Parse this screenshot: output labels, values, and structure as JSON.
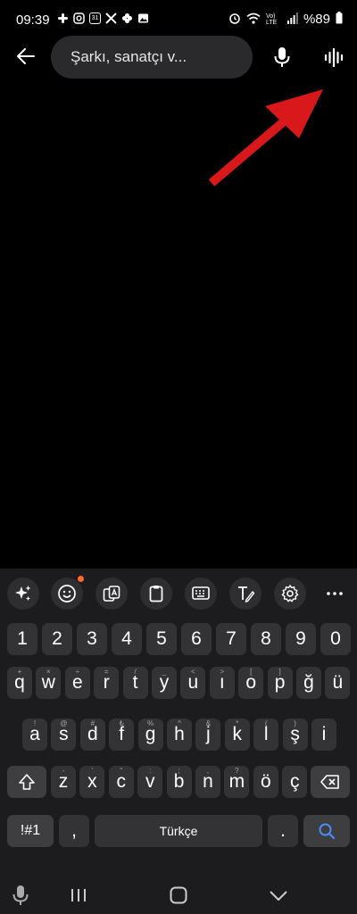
{
  "status_bar": {
    "time": "09:39",
    "notification_icons": [
      "slack-icon",
      "instagram-icon",
      "calendar-31-icon",
      "x-icon",
      "pinwheel-icon",
      "gallery-icon"
    ],
    "calendar_day": "31",
    "network_label": "Vo) LTE",
    "battery": "%89"
  },
  "search": {
    "placeholder": "Şarkı, sanatçı v..."
  },
  "keyboard": {
    "toolbar_icons": [
      "ai-sparkle-icon",
      "emoji-icon",
      "translate-icon",
      "clipboard-icon",
      "keyboard-mode-icon",
      "handwriting-icon",
      "settings-icon",
      "more-icon"
    ],
    "numbers": [
      "1",
      "2",
      "3",
      "4",
      "5",
      "6",
      "7",
      "8",
      "9",
      "0"
    ],
    "row1": [
      "q",
      "w",
      "e",
      "r",
      "t",
      "y",
      "u",
      "ı",
      "o",
      "p",
      "ğ",
      "ü"
    ],
    "row1_hints": [
      "+",
      "×",
      "÷",
      "=",
      "/",
      "_",
      "<",
      ">",
      "[",
      "]",
      "",
      ""
    ],
    "row2": [
      "a",
      "s",
      "d",
      "f",
      "g",
      "h",
      "j",
      "k",
      "l",
      "ş",
      "i"
    ],
    "row2_hints": [
      "!",
      "@",
      "#",
      "₺",
      "%",
      "^",
      "&",
      "*",
      "(",
      ")",
      ""
    ],
    "row3": [
      "z",
      "x",
      "c",
      "v",
      "b",
      "n",
      "m",
      "ö",
      "ç"
    ],
    "row3_hints": [
      "-",
      "'",
      "\"",
      ":",
      ";",
      ",",
      "?",
      "",
      ""
    ],
    "symbols_label": "!#1",
    "comma_label": ",",
    "space_label": "Türkçe",
    "period_label": ".",
    "accent_color": "#4a8cf7"
  },
  "colors": {
    "annotation_arrow": "#d9181c",
    "notification_dot": "#ff6a2a"
  }
}
